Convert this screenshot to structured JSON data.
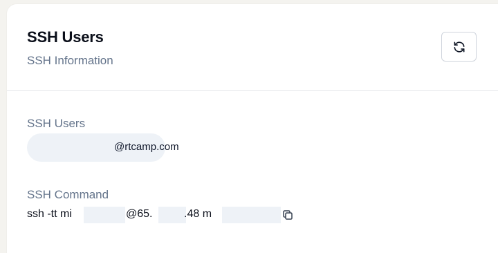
{
  "header": {
    "title": "SSH Users",
    "subtitle": "SSH Information",
    "refresh_icon": "refresh-icon"
  },
  "ssh_users": {
    "label": "SSH Users",
    "user_visible_text": "@rtcamp.com"
  },
  "ssh_command": {
    "label": "SSH Command",
    "part1": "ssh -tt mi",
    "part2": "@65.",
    "part3": ".48 m",
    "copy_icon": "copy-icon"
  },
  "colors": {
    "background": "#f4f3ef",
    "card": "#ffffff",
    "muted_text": "#64748b",
    "pill": "#eef2f7",
    "border": "#e5e7eb"
  }
}
